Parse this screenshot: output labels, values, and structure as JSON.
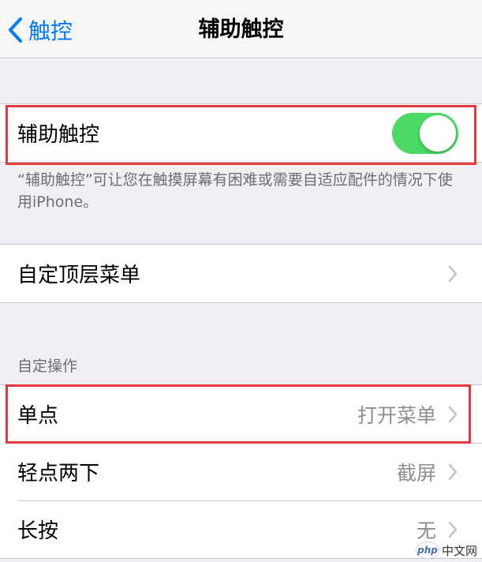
{
  "nav": {
    "back_label": "触控",
    "title": "辅助触控"
  },
  "assistive_touch": {
    "label": "辅助触控",
    "enabled": true,
    "footnote": "“辅助触控”可让您在触摸屏幕有困难或需要自适应配件的情况下使用iPhone。"
  },
  "top_menu": {
    "label": "自定顶层菜单"
  },
  "custom_actions": {
    "header": "自定操作",
    "items": [
      {
        "label": "单点",
        "value": "打开菜单"
      },
      {
        "label": "轻点两下",
        "value": "截屏"
      },
      {
        "label": "长按",
        "value": "无"
      }
    ]
  },
  "watermark": {
    "logo": "php",
    "text": "中文网"
  },
  "colors": {
    "accent": "#007aff",
    "toggle_on": "#4cd964",
    "highlight": "#e0393e"
  }
}
